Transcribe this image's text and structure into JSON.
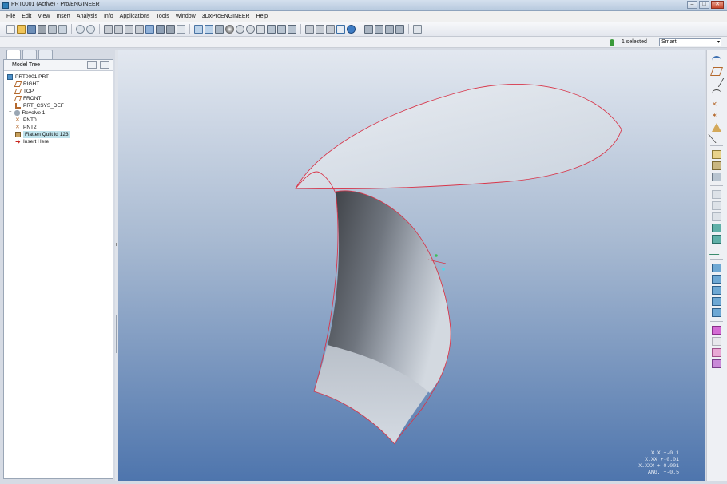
{
  "window": {
    "title": "PRT0001 (Active) - Pro/ENGINEER",
    "buttons": [
      "–",
      "□",
      "✕"
    ]
  },
  "menu": [
    "File",
    "Edit",
    "View",
    "Insert",
    "Analysis",
    "Info",
    "Applications",
    "Tools",
    "Window",
    "3DxProENGINEER",
    "Help"
  ],
  "status": {
    "selected": "1 selected",
    "filter": "Smart"
  },
  "model_tree": {
    "header": "Model Tree",
    "items": [
      {
        "label": "PRT0001.PRT",
        "icon": "part-icon"
      },
      {
        "label": "RIGHT",
        "icon": "datum-plane-icon"
      },
      {
        "label": "TOP",
        "icon": "datum-plane-icon"
      },
      {
        "label": "FRONT",
        "icon": "datum-plane-icon"
      },
      {
        "label": "PRT_CSYS_DEF",
        "icon": "csys-icon"
      },
      {
        "label": "Revolve 1",
        "icon": "revolve-icon"
      },
      {
        "label": "PNT0",
        "icon": "datum-point-icon"
      },
      {
        "label": "PNT2",
        "icon": "datum-point-icon"
      },
      {
        "label": "Flatten Quilt id 123",
        "icon": "flatten-quilt-icon"
      },
      {
        "label": "Insert Here",
        "icon": "insert-arrow-icon"
      }
    ]
  },
  "accuracy": [
    "X.X +-0.1",
    "X.XX +-0.01",
    "X.XXX +-0.001",
    "ANG. +-0.5"
  ],
  "colors": {
    "edge": "#d8364a",
    "viewport_top": "#e3e8f0",
    "viewport_bottom": "#4e75ad",
    "highlight": "#bfe3ec"
  }
}
